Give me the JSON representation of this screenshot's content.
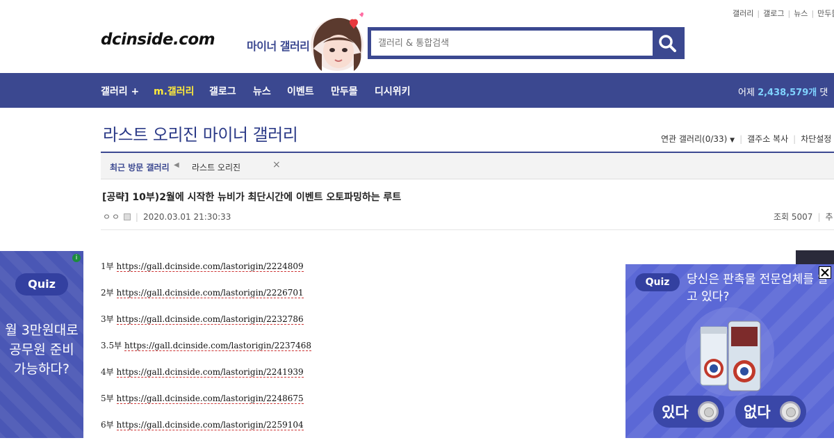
{
  "top_links": [
    "갤러리",
    "갤로그",
    "뉴스",
    "만두몰"
  ],
  "header": {
    "logo": "dcinside.com",
    "logo_sub": "마이너 갤러리",
    "search_placeholder": "갤러리 & 통합검색"
  },
  "nav": {
    "items": [
      "갤러리 +",
      "m.갤러리",
      "갤로그",
      "뉴스",
      "이벤트",
      "만두몰",
      "디시위키"
    ],
    "yesterday_label": "어제",
    "yesterday_count": "2,438,579개",
    "yesterday_suffix": "댓"
  },
  "gallery": {
    "title": "라스트 오리진 마이너 갤러리",
    "tools": [
      "연관 갤러리(0/33)",
      "갤주소 복사",
      "차단설정"
    ],
    "recent_label": "최근 방문 갤러리",
    "recent_item": "라스트 오리진"
  },
  "post": {
    "title": "[공략] 10부)2월에 시작한 뉴비가 최단시간에 이벤트 오토파밍하는 루트",
    "author": "ㅇㅇ",
    "date": "2020.03.01 21:30:33",
    "views": "조회 5007",
    "recommend": "추",
    "parts": [
      {
        "label": "1부",
        "url": "https://gall.dcinside.com/lastorigin/2224809"
      },
      {
        "label": "2부",
        "url": "https://gall.dcinside.com/lastorigin/2226701"
      },
      {
        "label": "3부",
        "url": "https://gall.dcinside.com/lastorigin/2232786"
      },
      {
        "label": "3.5부",
        "url": "https://gall.dcinside.com/lastorigin/2237468"
      },
      {
        "label": "4부",
        "url": "https://gall.dcinside.com/lastorigin/2241939"
      },
      {
        "label": "5부",
        "url": "https://gall.dcinside.com/lastorigin/2248675"
      },
      {
        "label": "6부",
        "url": "https://gall.dcinside.com/lastorigin/2259104"
      }
    ]
  },
  "ad_left": {
    "badge": "Quiz",
    "info": "i",
    "question": [
      "월 3만원대로",
      "공무원 준비",
      "가능하다?"
    ]
  },
  "ad_right": {
    "badge": "Quiz",
    "question": "당신은 판촉물 전문업체를 알고 있다?",
    "yes": "있다",
    "no": "없다"
  },
  "colors": {
    "primary": "#3b4890",
    "highlight": "#ffeb3b",
    "count": "#7fd3ff",
    "ad_bg": "#5b68d6"
  }
}
